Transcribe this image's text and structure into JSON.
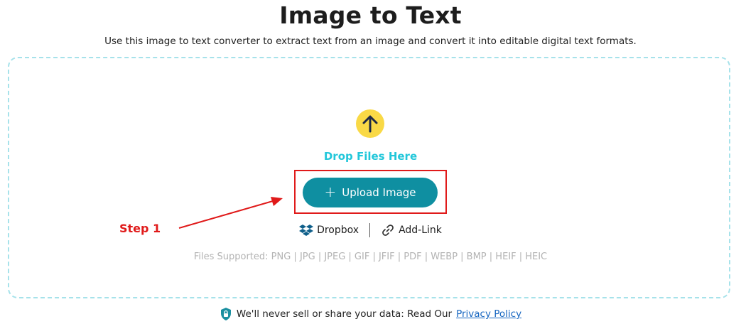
{
  "header": {
    "title": "Image to Text",
    "subtitle": "Use this image to text converter to extract text from an image and convert it into editable digital text formats."
  },
  "dropzone": {
    "upload_icon": "arrow-up-icon",
    "drop_label": "Drop Files Here",
    "upload_button_label": "Upload Image",
    "sources": [
      {
        "icon": "dropbox-icon",
        "label": "Dropbox"
      },
      {
        "icon": "link-icon",
        "label": "Add-Link"
      }
    ],
    "files_supported": "Files Supported: PNG | JPG | JPEG | GIF | JFIF | PDF | WEBP | BMP | HEIF | HEIC"
  },
  "annotation": {
    "step_label": "Step 1",
    "color": "#e01a1a"
  },
  "footer": {
    "shield_icon": "shield-lock-icon",
    "privacy_text": "We'll never sell or share your data: Read Our",
    "privacy_link": "Privacy Policy"
  },
  "colors": {
    "accent": "#0f8fa1",
    "drop_label": "#22c7da",
    "upload_circle": "#f9d946",
    "dashed_border": "#a6e2ea"
  }
}
